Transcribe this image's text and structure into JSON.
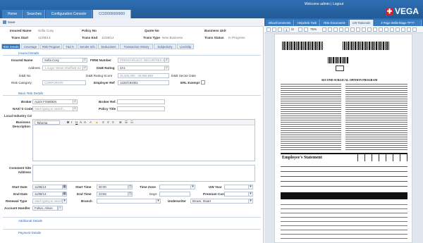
{
  "header": {
    "tabs": [
      "Home",
      "Searches",
      "Configuration Console",
      "CCID000000000"
    ],
    "welcome": "Welcome admin | Logout",
    "brand": "VEGA",
    "brand_icon": "cross-icon"
  },
  "toolbar": {
    "save": "Save"
  },
  "summary": {
    "insured_name_label": "Insured Name",
    "insured_name": "Sofia Cosy",
    "policy_no_label": "Policy No",
    "quote_no_label": "Quote No",
    "business_unit_label": "Business Unit",
    "trans_start_label": "Trans Start",
    "trans_start": "11/08/13",
    "trans_end_label": "Trans End",
    "trans_end": "11/08/14",
    "trans_type_label": "Trans Type",
    "trans_type": "New Business",
    "trans_status_label": "Trans Status",
    "trans_status": "In Progress"
  },
  "section_tabs": [
    "Risk Details",
    "Coverage",
    "Risk Program",
    "T&C's",
    "Sender Info",
    "Deductions",
    "Transaction History",
    "Subjectivity",
    "Line/Slip"
  ],
  "insured": {
    "title": "Insured Details",
    "name_label": "Insured Name",
    "name": "Sofia Cosy",
    "address_label": "Address",
    "address": "1 Augur Street Sheffield S2 1TF",
    "dbno_label": "D&B No",
    "risk_cat_label": "Risk Category",
    "risk_cat": "CORPORATE",
    "firm_label": "FIRM Number",
    "firm": "PRENOVELECC SECURITIES GROUP INC",
    "dbrating_label": "D&B Rating",
    "dbrating": "4A1",
    "dbscore_label": "D&B Rating Score",
    "dbscore": "25,000,000 - 49,999,999",
    "employer_label": "Employer Ref",
    "employer": "1220/C94301",
    "dbsector_label": "D&B Sector Date",
    "erl_label": "ERL Exempt"
  },
  "basic": {
    "title": "Basic Risk Details",
    "broker_label": "Broker",
    "broker": "ALEX FOWDEN",
    "broker_ref_label": "Broker Ref.",
    "naics_label": "NAIC'S Code",
    "naics": "Start typing to search...",
    "policy_title_label": "Policy Title",
    "local_label": "Local Industry Cd",
    "desc_label": "Business Description",
    "editor_font": "Tahoma",
    "comment_label": "Comment Site Address",
    "start_date_label": "Start Date",
    "start_date": "11/08/13",
    "end_date_label": "End Date",
    "end_date": "11/08/14",
    "start_time_label": "Start Time",
    "start_time": "00:00",
    "end_time_label": "End Time",
    "end_time": "23:59",
    "tz_label": "Time Zone",
    "days_label": "Days",
    "uw_year_label": "UW Year",
    "premium_label": "Premium Curr.",
    "renewal_label": "Renewal Type",
    "renewal": "Start typing to search...",
    "branch_label": "Branch",
    "underwriter_label": "Underwriter",
    "underwriter": "Brown, Stuart",
    "handler_label": "Account Handler",
    "handler": "Fulton, Alison"
  },
  "collapsed": [
    "Additional Details",
    "Payment Details"
  ],
  "right": {
    "tabs": [
      "Inbox/Comments",
      "Helpdesk Task",
      "Risk Documents",
      "UW Rationale",
      "4 Page WaferStage TP??"
    ],
    "page": "1",
    "pages": "/2",
    "zoom": "75%"
  },
  "doc": {
    "title": "SECOND SURGICAL OPINION PROGRAM",
    "stmt": "Employee's Statement"
  }
}
